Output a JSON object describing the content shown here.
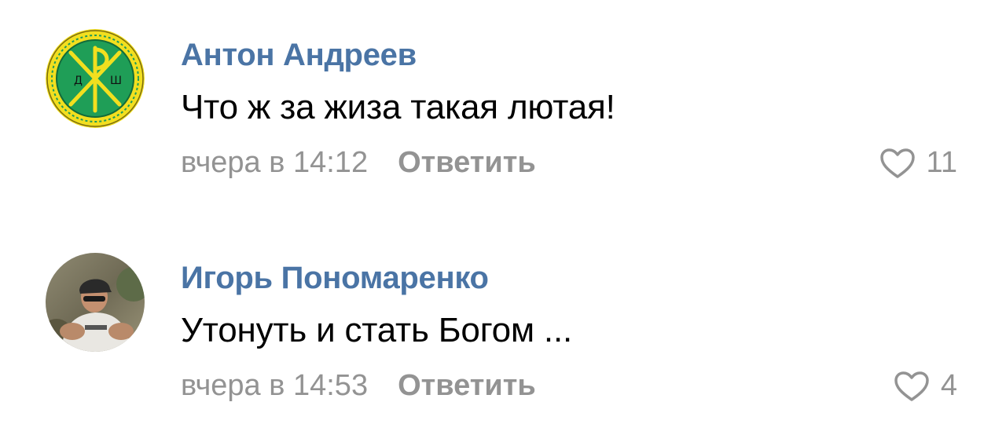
{
  "comments": [
    {
      "author": "Антон Андреев",
      "text": "Что ж за жиза такая лютая!",
      "date": "вчера в 14:12",
      "reply_label": "Ответить",
      "likes": "11",
      "avatar_letters": [
        "Д",
        "Ш"
      ]
    },
    {
      "author": "Игорь Пономаренко",
      "text": "Утонуть и стать Богом ...",
      "date": "вчера в 14:53",
      "reply_label": "Ответить",
      "likes": "4"
    }
  ],
  "colors": {
    "author": "#4a74a5",
    "meta": "#939393",
    "text": "#000000"
  }
}
